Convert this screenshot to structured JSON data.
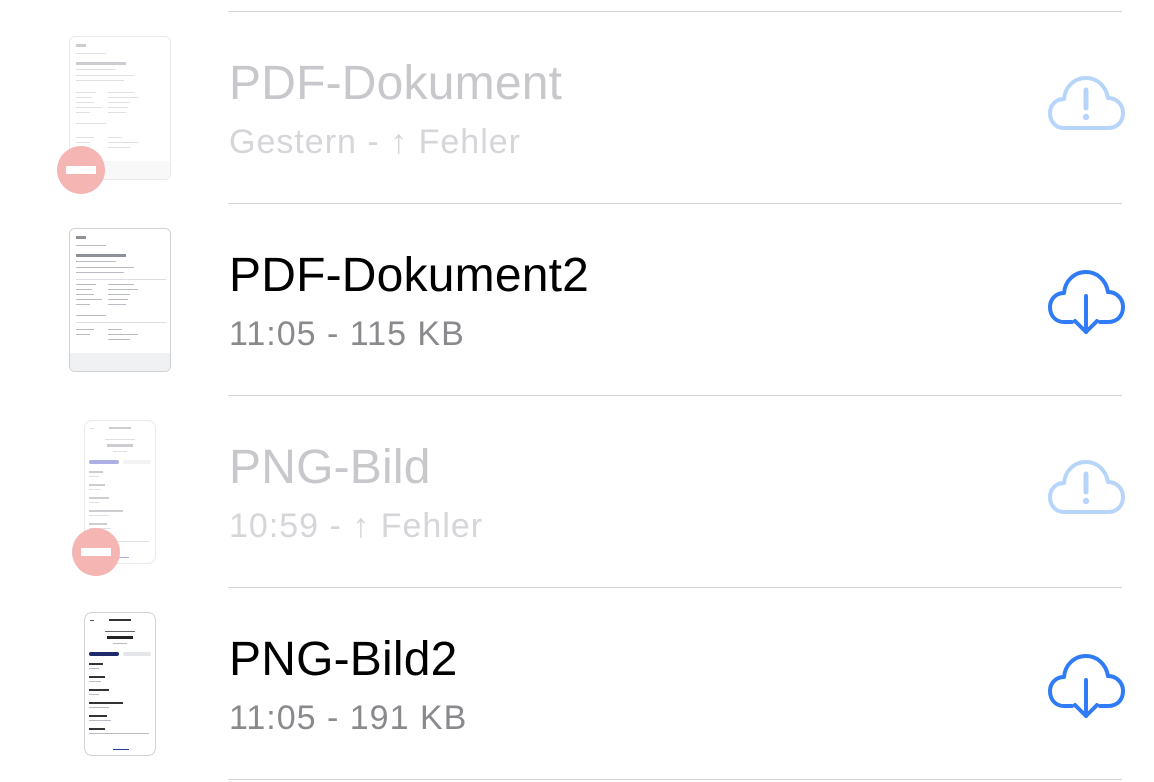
{
  "files": [
    {
      "title": "PDF-Dokument",
      "subtitle": "Gestern - ↑ Fehler",
      "status": "error",
      "kind": "pdf",
      "icon": "cloud-alert-icon"
    },
    {
      "title": "PDF-Dokument2",
      "subtitle": "11:05 - 115 KB",
      "status": "downloadable",
      "kind": "pdf",
      "icon": "cloud-download-icon"
    },
    {
      "title": "PNG-Bild",
      "subtitle": "10:59 - ↑ Fehler",
      "status": "error",
      "kind": "png",
      "icon": "cloud-alert-icon"
    },
    {
      "title": "PNG-Bild2",
      "subtitle": "11:05 - 191 KB",
      "status": "downloadable",
      "kind": "png",
      "icon": "cloud-download-icon"
    }
  ],
  "colors": {
    "accent": "#2f7cf6",
    "accent_faded": "#b7d4fb",
    "error_badge": "#f5b5b3",
    "title": "#000000",
    "subtitle": "#8a8a8e",
    "divider": "#d3d3d6"
  }
}
